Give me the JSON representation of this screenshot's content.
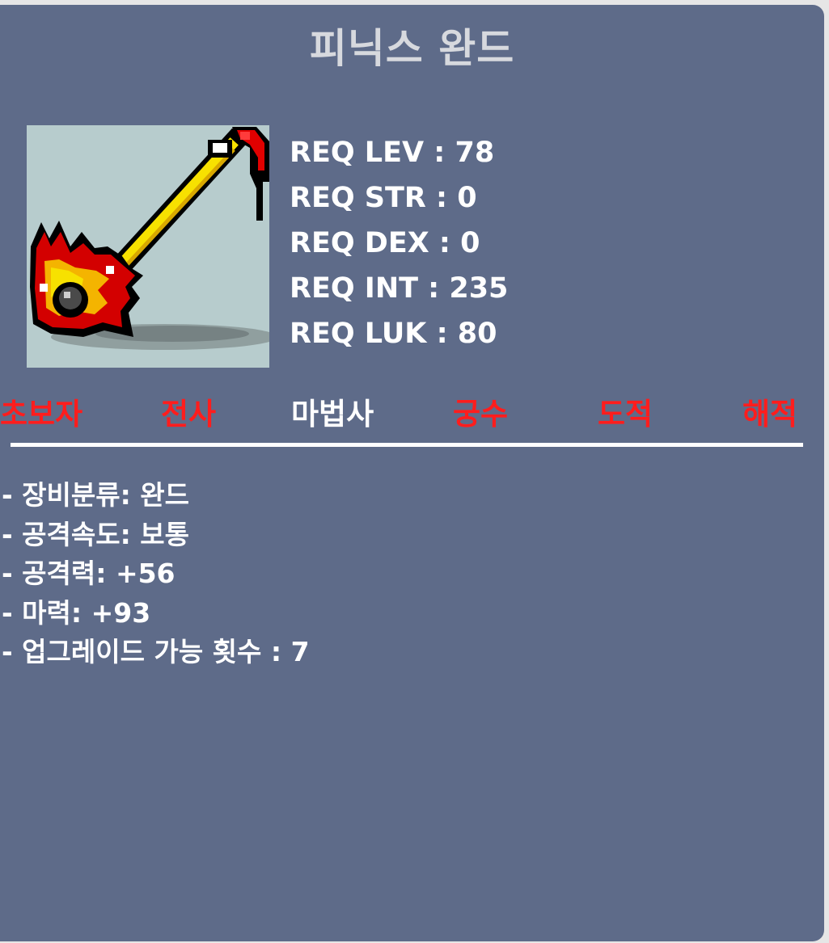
{
  "item": {
    "name": "피닉스 완드",
    "icon": "phoenix-wand-sprite"
  },
  "requirements": [
    "REQ LEV : 78",
    "REQ STR : 0",
    "REQ DEX : 0",
    "REQ INT : 235",
    "REQ LUK : 80"
  ],
  "jobs": [
    {
      "label": "초보자",
      "allowed": false
    },
    {
      "label": "전사",
      "allowed": false
    },
    {
      "label": "마법사",
      "allowed": true
    },
    {
      "label": "궁수",
      "allowed": false
    },
    {
      "label": "도적",
      "allowed": false
    },
    {
      "label": "해적",
      "allowed": false
    }
  ],
  "colors": {
    "panel": "#5e6b89",
    "allowed": "#ffffff",
    "disallowed": "#ff1d1d",
    "title": "#d7d9de"
  },
  "stats": [
    "- 장비분류: 완드",
    "- 공격속도: 보통",
    "- 공격력: +56",
    "- 마력: +93",
    "- 업그레이드 가능 횟수 : 7"
  ]
}
